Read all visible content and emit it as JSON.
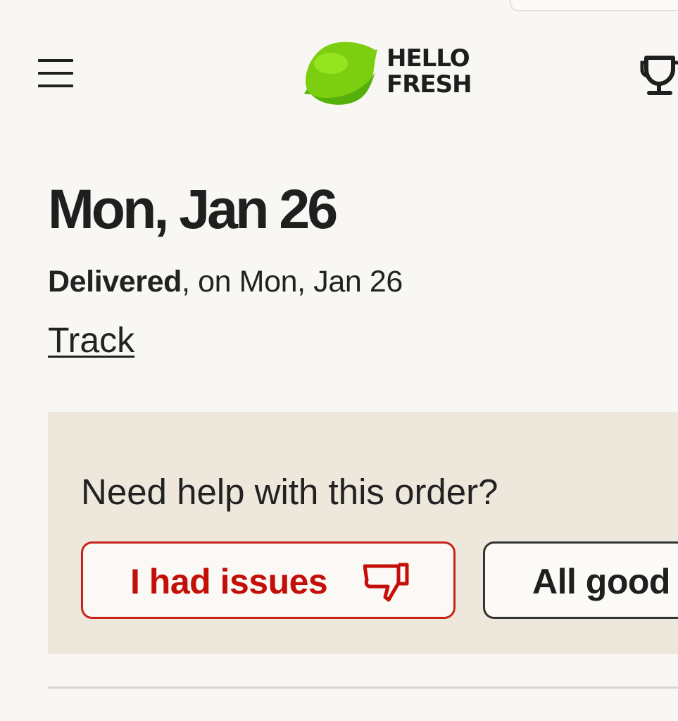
{
  "brand": {
    "line1": "HELLO",
    "line2": "FRESH",
    "colors": {
      "lime": "#7ccf10",
      "lime_dark": "#48a30a",
      "accent_red": "#c40f08",
      "panel": "#ede7dc"
    }
  },
  "header": {
    "menu_icon": "hamburger-menu-icon",
    "logo_icon": "lime-logo-icon",
    "trophy_icon": "trophy-icon"
  },
  "order": {
    "title": "Mon, Jan 26",
    "status_bold": "Delivered",
    "status_rest": ", on Mon, Jan 26",
    "track_label": "Track"
  },
  "help": {
    "question": "Need help with this order?",
    "issues_label": "I had issues",
    "issues_icon": "thumbs-down-icon",
    "good_label": "All good"
  }
}
